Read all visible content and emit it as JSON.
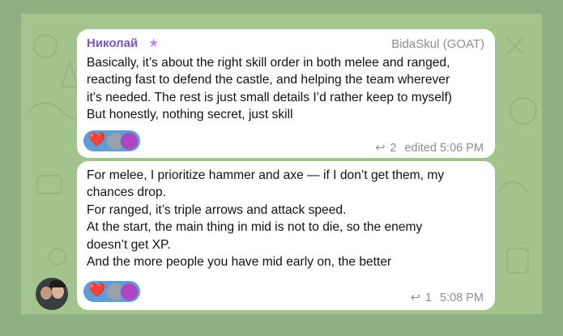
{
  "messages": [
    {
      "author": "Николай",
      "author_star": "★",
      "role": "BidaSkul (GOAT)",
      "text": "Basically, it’s about the right skill order in both melee and ranged,\nreacting fast to defend the castle, and helping the team wherever\nit’s needed. The rest is just small details I’d rather keep to myself)\nBut honestly, nothing secret, just skill",
      "reaction_emoji": "❤️",
      "reply_icon": "↩",
      "reply_count": "2",
      "time": "edited 5:06 PM"
    },
    {
      "text": "For melee, I prioritize hammer and axe — if I don’t get them, my\nchances drop.\nFor ranged, it’s triple arrows and attack speed.\nAt the start, the main thing in mid is not to die, so the enemy\ndoesn’t get XP.\nAnd the more people you have mid early on, the better",
      "reaction_emoji": "❤️",
      "reply_icon": "↩",
      "reply_count": "1",
      "time": "5:08 PM"
    }
  ],
  "colors": {
    "author": "#7b54c7",
    "reaction_bg": "#5f9dd6",
    "meta": "#8b8f94",
    "chat_bg": "#a3c48c"
  }
}
